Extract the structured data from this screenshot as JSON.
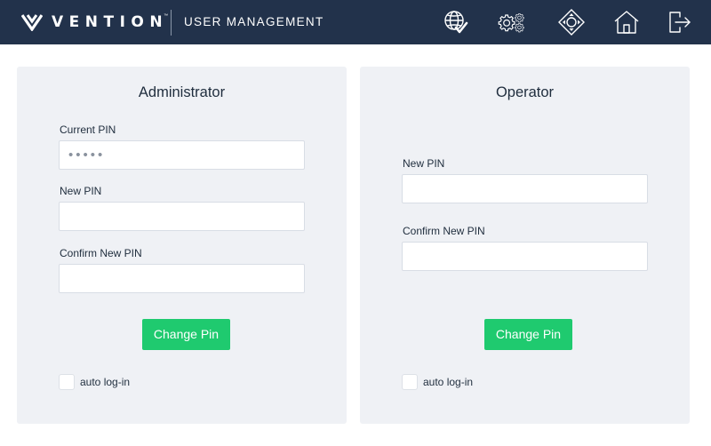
{
  "header": {
    "brand": "VENTION",
    "brand_tm": "™",
    "section": "USER MANAGEMENT",
    "icons": [
      "globe-check-icon",
      "settings-gears-icon",
      "jog-direction-icon",
      "home-icon",
      "logout-icon"
    ]
  },
  "admin": {
    "title": "Administrator",
    "current_pin_label": "Current PIN",
    "current_pin_value": "•••••",
    "new_pin_label": "New PIN",
    "new_pin_value": "",
    "confirm_pin_label": "Confirm New PIN",
    "confirm_pin_value": "",
    "button_label": "Change Pin",
    "auto_login_label": "auto log-in",
    "auto_login_checked": false
  },
  "operator": {
    "title": "Operator",
    "new_pin_label": "New PIN",
    "new_pin_value": "",
    "confirm_pin_label": "Confirm New PIN",
    "confirm_pin_value": "",
    "button_label": "Change Pin",
    "auto_login_label": "auto log-in",
    "auto_login_checked": false
  },
  "colors": {
    "header_bg": "#22324b",
    "panel_bg": "#eff1f5",
    "accent_green": "#1fca6f",
    "text_dark": "#1f2d3d"
  }
}
